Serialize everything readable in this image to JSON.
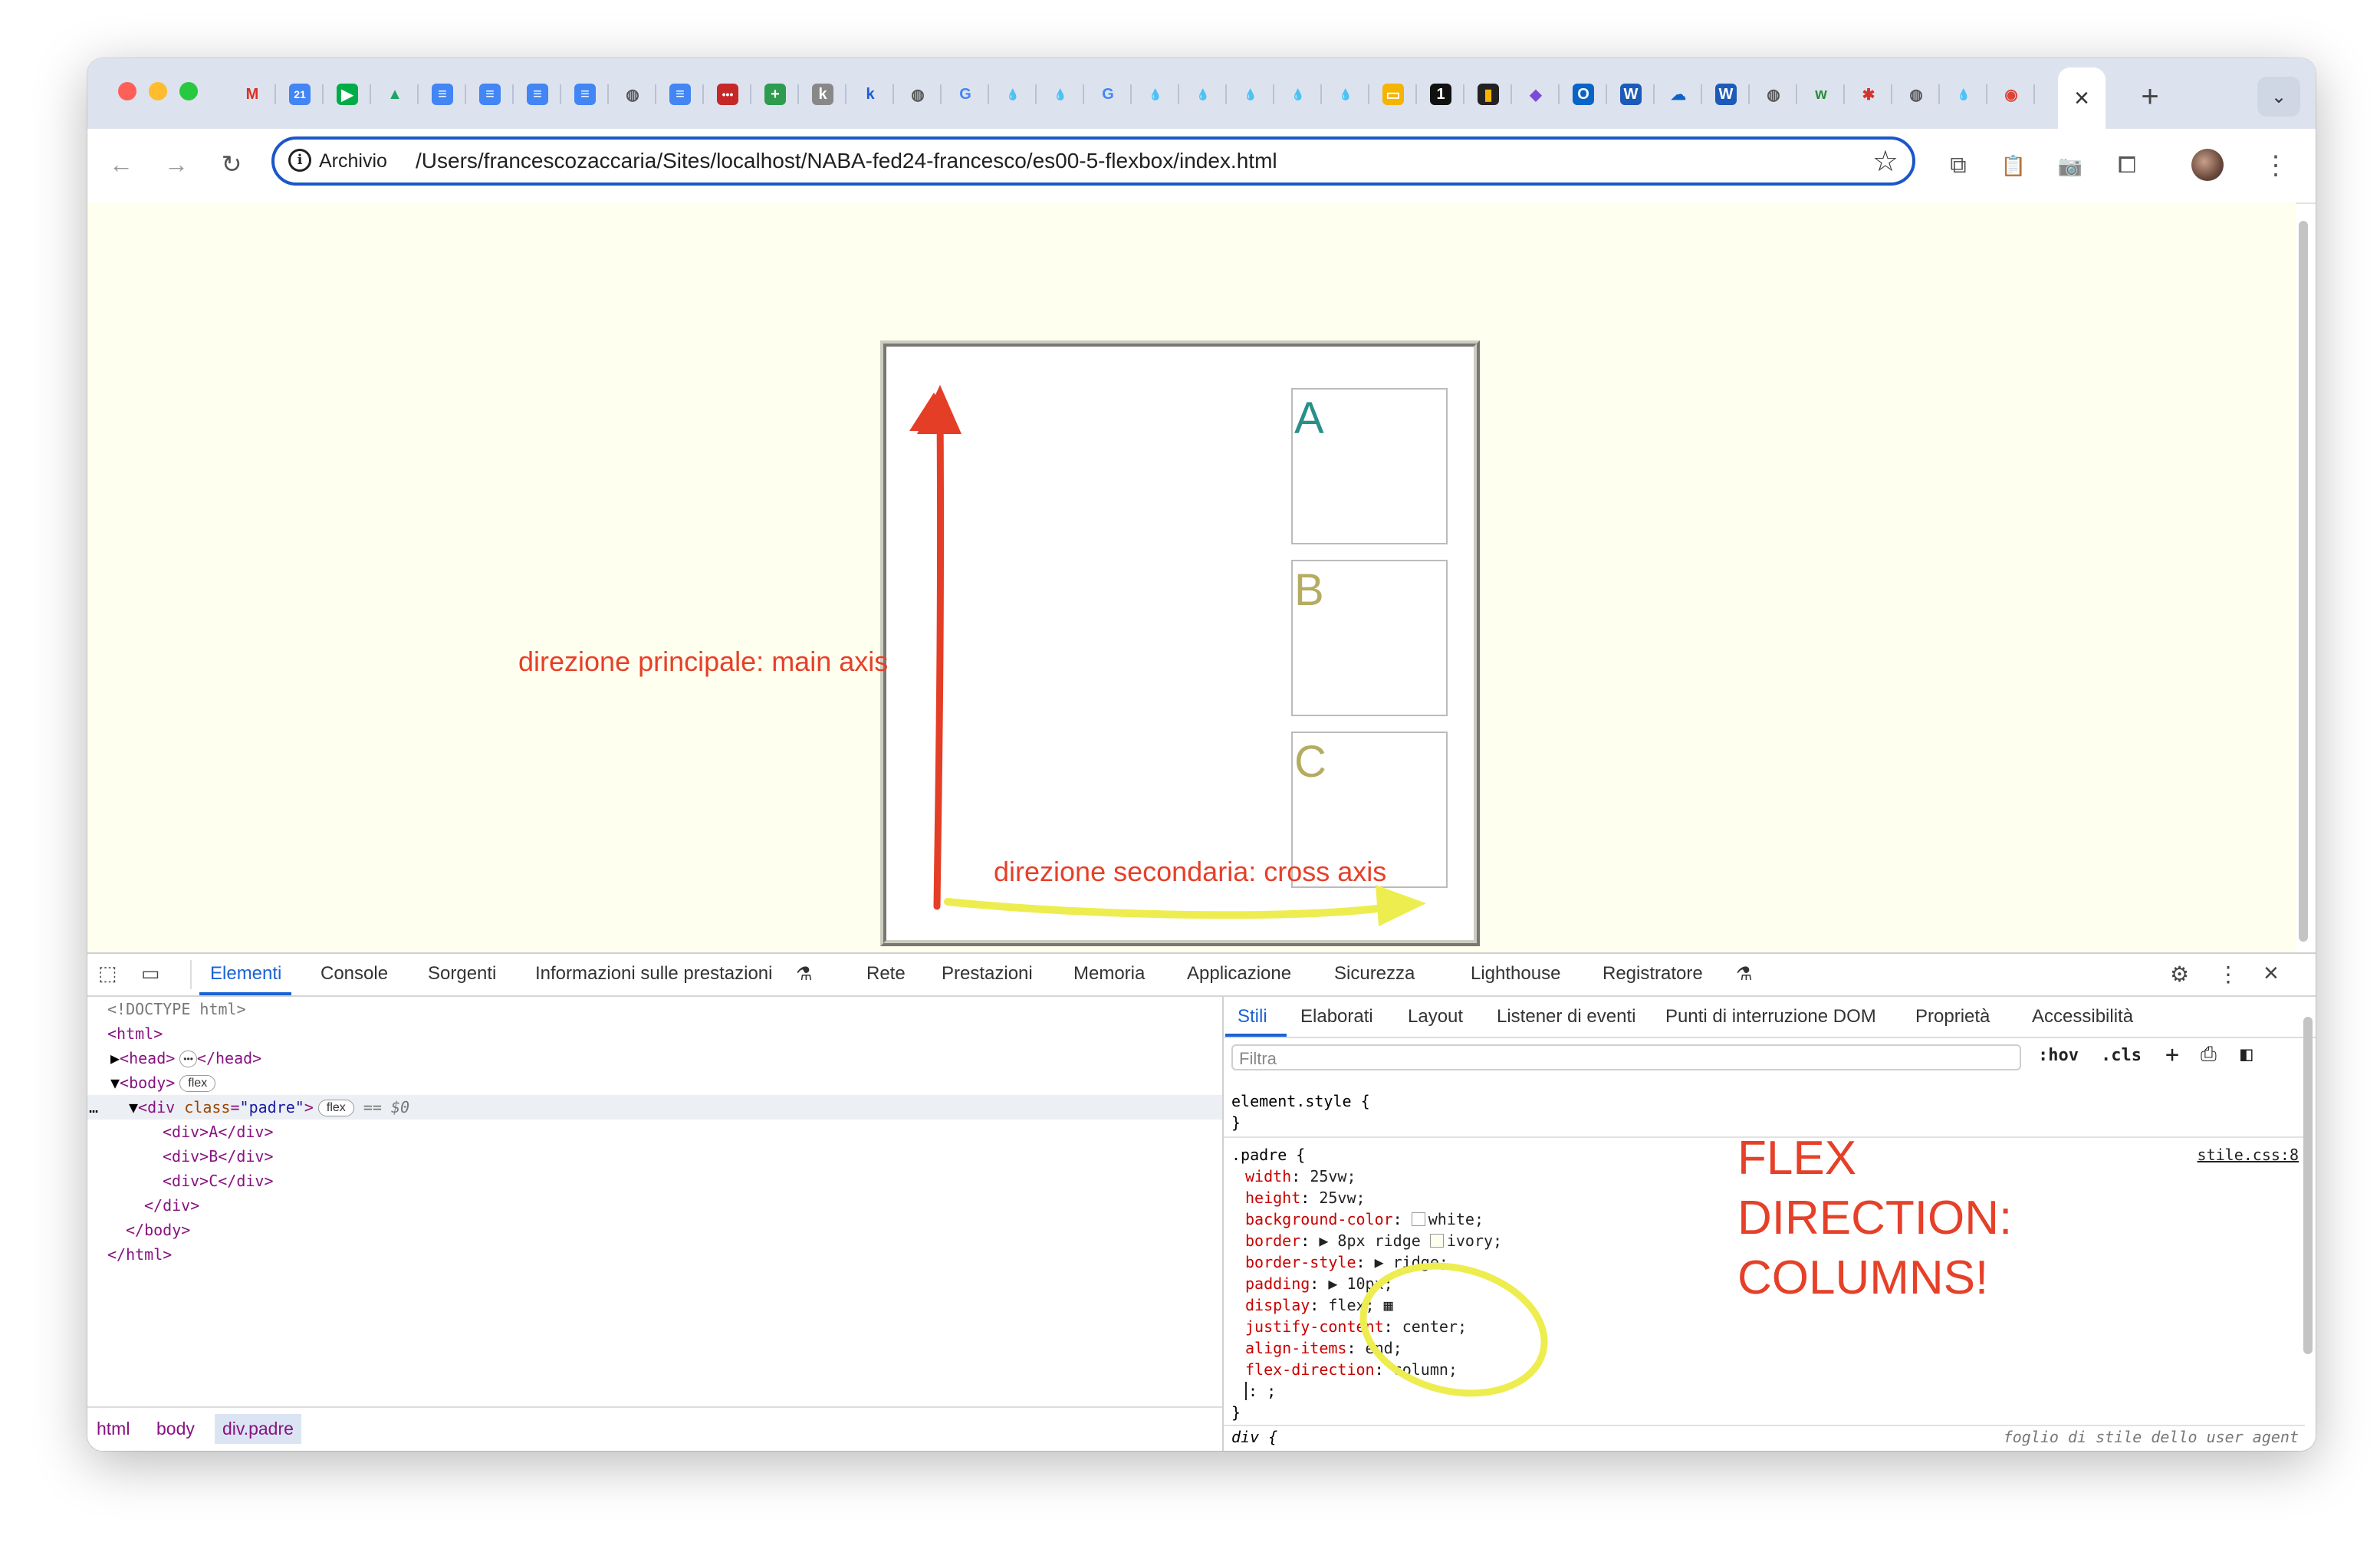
{
  "tabs": {
    "icons": [
      {
        "name": "gmail-icon",
        "glyph": "M",
        "bg": "transparent",
        "fg": "#d93025"
      },
      {
        "name": "calendar-icon",
        "glyph": "21",
        "bg": "#4285f4",
        "fg": "#fff"
      },
      {
        "name": "meet-icon",
        "glyph": "▶",
        "bg": "#00ac47",
        "fg": "#fff"
      },
      {
        "name": "drive-icon",
        "glyph": "▲",
        "bg": "transparent",
        "fg": "#1fa463"
      },
      {
        "name": "docs-icon",
        "glyph": "≡",
        "bg": "#4285f4",
        "fg": "#fff"
      },
      {
        "name": "docs-icon",
        "glyph": "≡",
        "bg": "#4285f4",
        "fg": "#fff"
      },
      {
        "name": "docs-icon",
        "glyph": "≡",
        "bg": "#4285f4",
        "fg": "#fff"
      },
      {
        "name": "docs-icon",
        "glyph": "≡",
        "bg": "#4285f4",
        "fg": "#fff"
      },
      {
        "name": "globe-icon",
        "glyph": "◍",
        "bg": "transparent",
        "fg": "#555"
      },
      {
        "name": "docs-icon",
        "glyph": "≡",
        "bg": "#4285f4",
        "fg": "#fff"
      },
      {
        "name": "dots-icon",
        "glyph": "•••",
        "bg": "#c62828",
        "fg": "#fff"
      },
      {
        "name": "plus-square-icon",
        "glyph": "+",
        "bg": "#2e9b4f",
        "fg": "#fff"
      },
      {
        "name": "k-icon",
        "glyph": "k",
        "bg": "#888",
        "fg": "#fff"
      },
      {
        "name": "k-blue-icon",
        "glyph": "k",
        "bg": "transparent",
        "fg": "#1e5bd8"
      },
      {
        "name": "globe-icon",
        "glyph": "◍",
        "bg": "transparent",
        "fg": "#555"
      },
      {
        "name": "google-icon",
        "glyph": "G",
        "bg": "transparent",
        "fg": "#4285f4"
      },
      {
        "name": "drupal-icon",
        "glyph": "💧",
        "bg": "transparent",
        "fg": "#2a73c8"
      },
      {
        "name": "drupal-icon",
        "glyph": "💧",
        "bg": "transparent",
        "fg": "#2a73c8"
      },
      {
        "name": "google-icon",
        "glyph": "G",
        "bg": "transparent",
        "fg": "#4285f4"
      },
      {
        "name": "drupal-icon",
        "glyph": "💧",
        "bg": "transparent",
        "fg": "#2a73c8"
      },
      {
        "name": "drupal-icon",
        "glyph": "💧",
        "bg": "transparent",
        "fg": "#2a73c8"
      },
      {
        "name": "drupal-icon",
        "glyph": "💧",
        "bg": "transparent",
        "fg": "#2a73c8"
      },
      {
        "name": "drupal-icon",
        "glyph": "💧",
        "bg": "transparent",
        "fg": "#2a73c8"
      },
      {
        "name": "drupal-icon",
        "glyph": "💧",
        "bg": "transparent",
        "fg": "#2a73c8"
      },
      {
        "name": "slides-icon",
        "glyph": "▭",
        "bg": "#f4b400",
        "fg": "#fff"
      },
      {
        "name": "notification-icon",
        "glyph": "1",
        "bg": "#111",
        "fg": "#fff"
      },
      {
        "name": "chart-icon",
        "glyph": "▮",
        "bg": "#222",
        "fg": "#f4b400"
      },
      {
        "name": "copilot-icon",
        "glyph": "◆",
        "bg": "transparent",
        "fg": "#7b4bd8"
      },
      {
        "name": "outlook-icon",
        "glyph": "O",
        "bg": "#0a64c6",
        "fg": "#fff"
      },
      {
        "name": "word-icon",
        "glyph": "W",
        "bg": "#1c5bb8",
        "fg": "#fff"
      },
      {
        "name": "onedrive-icon",
        "glyph": "☁",
        "bg": "transparent",
        "fg": "#0a64c6"
      },
      {
        "name": "word-icon",
        "glyph": "W",
        "bg": "#1c5bb8",
        "fg": "#fff"
      },
      {
        "name": "globe-icon",
        "glyph": "◍",
        "bg": "transparent",
        "fg": "#555"
      },
      {
        "name": "w-green-icon",
        "glyph": "w",
        "bg": "transparent",
        "fg": "#2e8b3a"
      },
      {
        "name": "asterisk-icon",
        "glyph": "✱",
        "bg": "transparent",
        "fg": "#d6322c"
      },
      {
        "name": "globe-icon",
        "glyph": "◍",
        "bg": "transparent",
        "fg": "#555"
      },
      {
        "name": "drupal-icon",
        "glyph": "💧",
        "bg": "transparent",
        "fg": "#2a73c8"
      },
      {
        "name": "chrome-icon",
        "glyph": "◉",
        "bg": "transparent",
        "fg": "#db4437"
      }
    ],
    "active_close": "×",
    "new_tab": "+",
    "tab_menu": "⌄"
  },
  "toolbar": {
    "back": "←",
    "forward": "→",
    "reload": "↻",
    "info": "i",
    "security_label": "Archivio",
    "url": "/Users/francescozaccaria/Sites/localhost/NABA-fed24-francesco/es00-5-flexbox/index.html",
    "star": "☆",
    "pip": "⧉",
    "clipboard": "📋",
    "camera": "📷",
    "extensions": "⧠",
    "menu": "⋮"
  },
  "page": {
    "children": [
      "A",
      "B",
      "C"
    ],
    "child_colors": [
      "#2a8f8a",
      "#b5ac62",
      "#b5ac62"
    ],
    "main_axis_label": "direzione principale: main axis",
    "cross_axis_label": "direzione secondaria: cross axis",
    "flex_note": "FLEX\nDIRECTION:\nCOLUMNS!",
    "colors": {
      "annotation_red": "#e64029",
      "arrow_red": "#e53e26",
      "arrow_yellow": "#eded4f",
      "page_bg": "#fffff0"
    }
  },
  "devtools": {
    "tabs": [
      "Elementi",
      "Console",
      "Sorgenti",
      "Informazioni sulle prestazioni",
      "Rete",
      "Prestazioni",
      "Memoria",
      "Applicazione",
      "Sicurezza",
      "Lighthouse",
      "Registratore"
    ],
    "flask": "⚗",
    "gear": "⚙",
    "more": "⋮",
    "close": "×",
    "dom": {
      "doctype": "<!DOCTYPE html>",
      "html_open": "<html>",
      "head_open": "<head>",
      "head_close": "</head>",
      "ellipsis": "•••",
      "body_open": "<body>",
      "flex_badge": "flex",
      "div_open_tag": "<div ",
      "div_attr": "class",
      "div_eq": "=",
      "div_val": "\"padre\"",
      "div_gt": ">",
      "dollar": "== $0",
      "children": [
        "<div>A</div>",
        "<div>B</div>",
        "<div>C</div>"
      ],
      "div_close": "</div>",
      "body_close": "</body>",
      "html_close": "</html>",
      "row_dots": "…"
    },
    "breadcrumbs": [
      "html",
      "body",
      "div.padre"
    ],
    "styles": {
      "tabs": [
        "Stili",
        "Elaborati",
        "Layout",
        "Listener di eventi",
        "Punti di interruzione DOM",
        "Proprietà",
        "Accessibilità"
      ],
      "filter_placeholder": "Filtra",
      "hov": ":hov",
      "cls": ".cls",
      "element_style": "element.style {",
      "close_brace": "}",
      "selector": ".padre {",
      "source": "stile.css:8",
      "declarations": [
        {
          "prop": "width",
          "val": "25vw;"
        },
        {
          "prop": "height",
          "val": "25vw;"
        },
        {
          "prop": "background-color",
          "val": "white;",
          "swatch": "#ffffff"
        },
        {
          "prop": "border",
          "val": "▶ 8px ridge ",
          "swatch2": "#fffff0",
          "val2": "ivory;"
        },
        {
          "prop": "border-style",
          "val": "▶ ridge;"
        },
        {
          "prop": "padding",
          "val": "▶ 10px;"
        },
        {
          "prop": "display",
          "val": "flex; ▦"
        },
        {
          "prop": "justify-content",
          "val": "center;"
        },
        {
          "prop": "align-items",
          "val": "end;"
        },
        {
          "prop": "flex-direction",
          "val": "column;"
        }
      ],
      "editing": ": ;",
      "ua_selector": "div {",
      "ua_source": "foglio di stile dello user agent"
    }
  }
}
